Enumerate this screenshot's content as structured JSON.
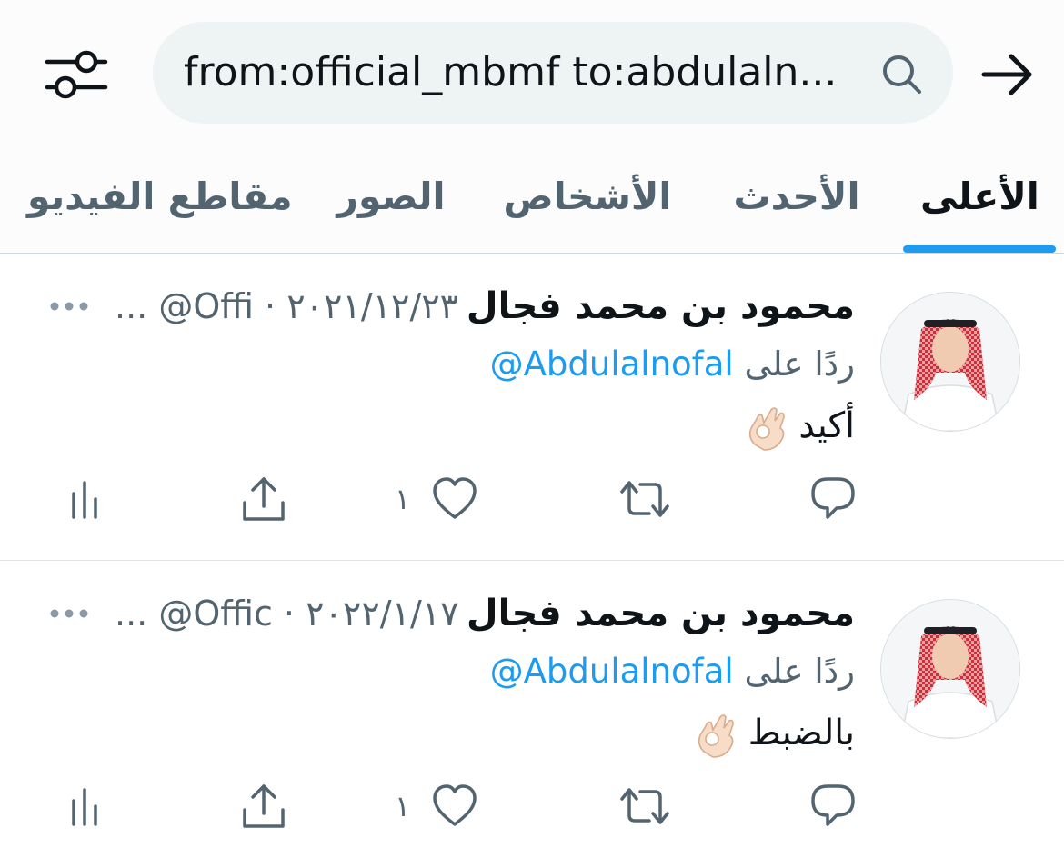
{
  "search": {
    "query": "from:official_mbmf to:abdulaln..."
  },
  "tabs": [
    {
      "label": "الأعلى",
      "active": true
    },
    {
      "label": "الأحدث",
      "active": false
    },
    {
      "label": "الأشخاص",
      "active": false
    },
    {
      "label": "الصور",
      "active": false
    },
    {
      "label": "مقاطع الفيديو",
      "active": false
    }
  ],
  "tweets": [
    {
      "author_name": "محمود بن محمد فجال",
      "meta": "... @Offi · ٢٠٢١/١٢/٢٣",
      "reply_prefix": "ردًا على",
      "reply_to": "@Abdulalnofal",
      "text": "أكيد",
      "emoji": "ok-hand",
      "like_count": "١"
    },
    {
      "author_name": "محمود بن محمد فجال",
      "meta": "... @Offic · ٢٠٢٢/١/١٧",
      "reply_prefix": "ردًا على",
      "reply_to": "@Abdulalnofal",
      "text": "بالضبط",
      "emoji": "ok-hand",
      "like_count": "١"
    }
  ],
  "icons": {
    "filter": "sliders-icon",
    "search": "search-icon",
    "back": "arrow-right-icon",
    "more": "more-horizontal-icon",
    "reply": "reply-bubble-icon",
    "retweet": "retweet-icon",
    "like": "heart-icon",
    "share": "share-icon",
    "views": "analytics-icon"
  },
  "colors": {
    "accent": "#1d9bf0",
    "text_primary": "#0f1419",
    "text_secondary": "#536471",
    "search_bg": "#eef3f4"
  }
}
